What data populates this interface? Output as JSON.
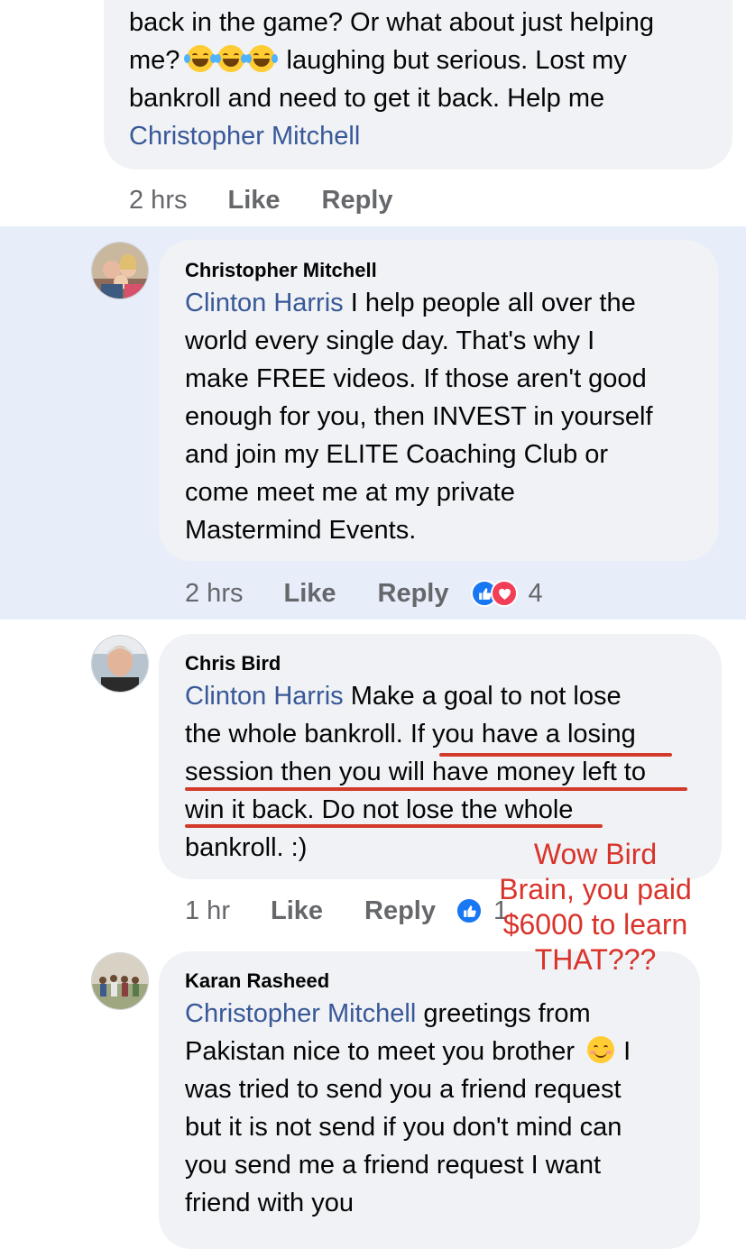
{
  "comments": {
    "top": {
      "lines": [
        "back in the game? Or what about just helping",
        "laughing but serious. Lost my",
        "bankroll and need to get it back. Help me"
      ],
      "line2_prefix": "me?",
      "mention": "Christopher Mitchell",
      "time": "2 hrs",
      "like": "Like",
      "reply": "Reply"
    },
    "christopher": {
      "name": "Christopher Mitchell",
      "mention": "Clinton Harris",
      "lines": [
        " I help people all over the",
        "world every single day. That's why I",
        "make FREE videos. If those aren't good",
        "enough for you, then INVEST in yourself",
        "and join my ELITE Coaching Club or",
        "come meet me at my private",
        "Mastermind Events."
      ],
      "time": "2 hrs",
      "like": "Like",
      "reply": "Reply",
      "reaction_count": "4"
    },
    "chris_bird": {
      "name": "Chris Bird",
      "mention": "Clinton Harris",
      "lines": [
        " Make a goal to not lose",
        "the whole bankroll. If you have a losing",
        "session then you will have money left to",
        "win it back. Do not lose the whole",
        "bankroll. :)"
      ],
      "time": "1 hr",
      "like": "Like",
      "reply": "Reply",
      "reaction_count": "1"
    },
    "karan": {
      "name": "Karan Rasheed",
      "mention": "Christopher Mitchell",
      "lines": [
        " greetings from",
        "Pakistan nice to meet you brother",
        "I",
        "was tried to send you a friend request",
        "but it is not send if you don't mind can",
        "you send me a friend request I want",
        "friend with you"
      ]
    }
  },
  "annotation": {
    "lines": [
      "Wow Bird",
      "Brain, you paid",
      "$6000 to learn",
      "THAT???"
    ]
  },
  "colors": {
    "highlight_bg": "#e7edf9",
    "bubble_bg": "#f0f2f5",
    "link": "#385898",
    "annotation": "#d9332a"
  }
}
